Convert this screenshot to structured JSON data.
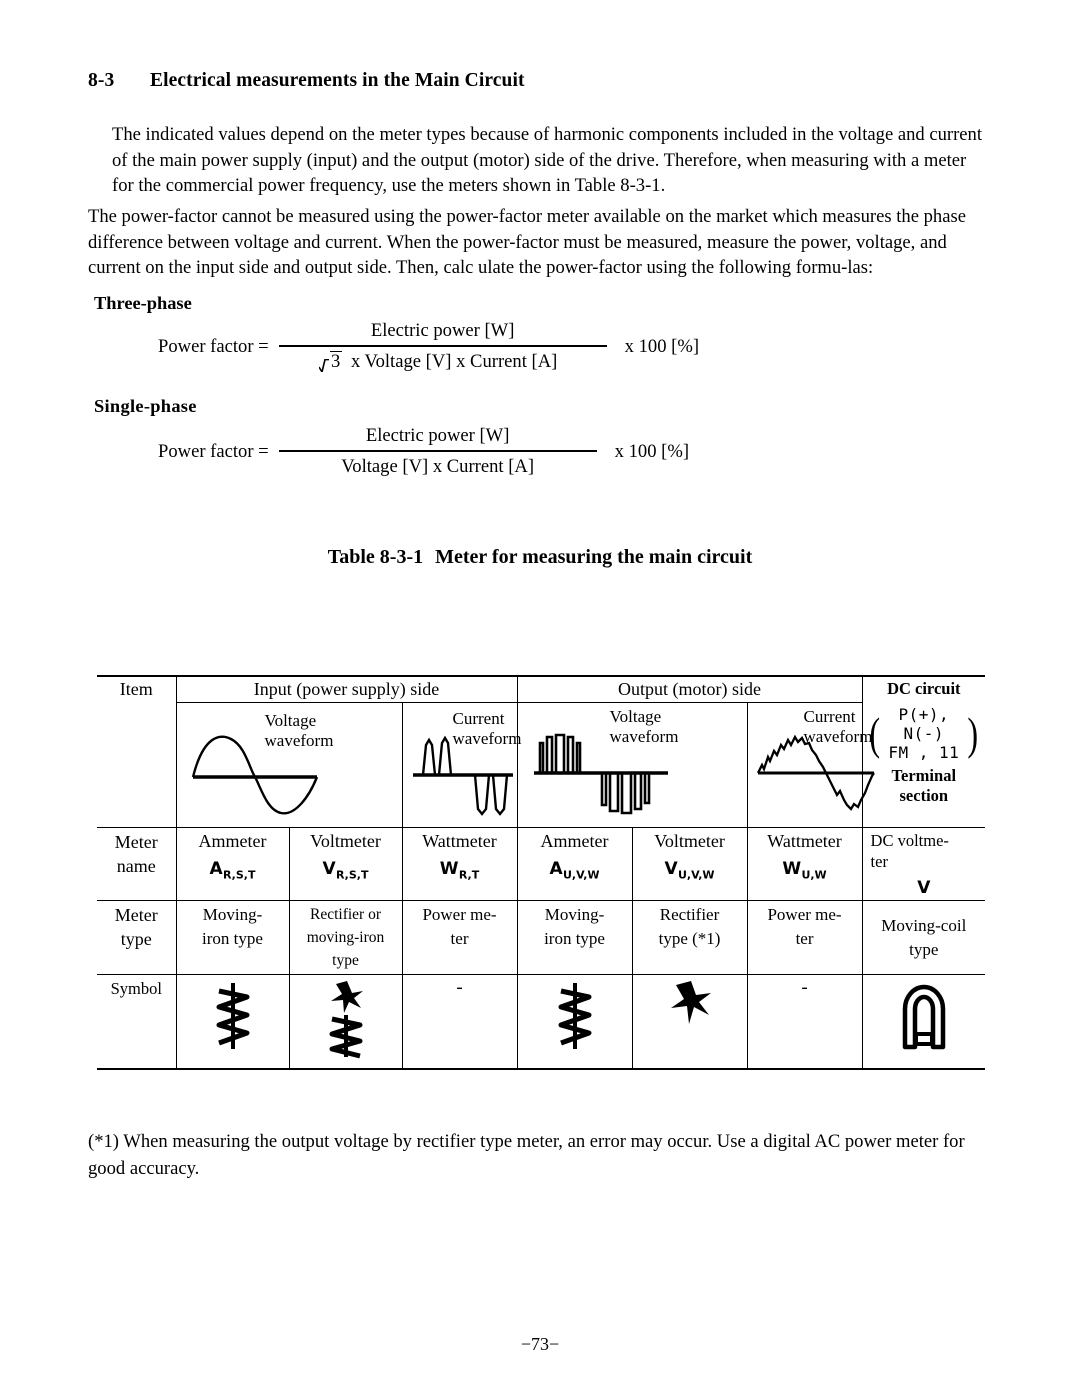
{
  "section": {
    "number": "8-3",
    "title": "Electrical measurements in the Main Circuit"
  },
  "paragraphs": {
    "p1": "The indicated values depend on the meter types because of harmonic components included in the voltage and current of the main power supply (input) and the output (motor) side of the drive.  Therefore, when measuring with a meter for the commercial power frequency, use the meters shown in Table 8-3-1.",
    "p2": "The power-factor cannot be measured using the power-factor meter available on the market which measures the phase difference between voltage and current.  When the power-factor must be measured, measure the power, voltage, and current on the input side and output side. Then, calc ulate the power-factor using the following formu-las:"
  },
  "formulas": {
    "three_phase": {
      "heading": "Three-phase",
      "lhs": "Power factor =",
      "numerator": "Electric power [W]",
      "denominator_sqrt": "3",
      "denominator_rest": "x Voltage [V] x Current [A]",
      "multiplier": "x 100 [%]"
    },
    "single_phase": {
      "heading": "Single-phase",
      "lhs": "Power factor =",
      "numerator": "Electric power [W]",
      "denominator": "Voltage [V] x Current [A]",
      "multiplier": "x 100 [%]"
    }
  },
  "table": {
    "caption_label": "Table 8-3-1",
    "caption_title": "Meter for measuring the main circuit",
    "header": {
      "item": "Item",
      "input_side": "Input (power supply) side",
      "output_side": "Output (motor) side",
      "dc_circuit": "DC circuit"
    },
    "waveforms": {
      "input_voltage": "Voltage\nwaveform",
      "input_voltage_l1": "Voltage",
      "input_voltage_l2": "waveform",
      "input_current_l1": "Current",
      "input_current_l2": "waveform",
      "output_voltage_l1": "Voltage",
      "output_voltage_l2": "waveform",
      "output_current_l1": "Current",
      "output_current_l2": "waveform"
    },
    "dc_cell": {
      "title": "DC circuit",
      "matrix_row1": "P(+), N(-)",
      "matrix_row2": "FM ,  11",
      "terminal_l1": "Terminal",
      "terminal_l2": "section"
    },
    "rows": {
      "meter_name": {
        "label_l1": "Meter",
        "label_l2": "name",
        "cells": [
          {
            "name": "Ammeter",
            "symbol": "A",
            "sub": "R,S,T"
          },
          {
            "name": "Voltmeter",
            "symbol": "V",
            "sub": "R,S,T"
          },
          {
            "name": "Wattmeter",
            "symbol": "W",
            "sub": "R,T"
          },
          {
            "name": "Ammeter",
            "symbol": "A",
            "sub": "U,V,W"
          },
          {
            "name": "Voltmeter",
            "symbol": "V",
            "sub": "U,V,W"
          },
          {
            "name": "Wattmeter",
            "symbol": "W",
            "sub": "U,W"
          }
        ],
        "dc": {
          "line1": "DC   voltme-",
          "line2": "ter",
          "symbol": "V"
        }
      },
      "meter_type": {
        "label_l1": "Meter",
        "label_l2": "type",
        "cells": [
          "Moving-\niron type",
          "Rectifier or\nmoving-iron\ntype",
          "Power me-\nter",
          "Moving-\niron type",
          "Rectifier\ntype (*1)",
          "Power me-\nter",
          "Moving-coil\ntype"
        ]
      },
      "symbol": {
        "label": "Symbol",
        "cells": [
          "moving-iron-symbol",
          "rectifier-moving-iron-symbol",
          "-",
          "moving-iron-symbol",
          "rectifier-symbol",
          "-",
          "moving-coil-symbol"
        ]
      }
    }
  },
  "footnote": "(*1) When measuring the output voltage by rectifier type meter, an error may occur. Use a digital AC power meter for good accuracy.",
  "page_number": "−73−"
}
